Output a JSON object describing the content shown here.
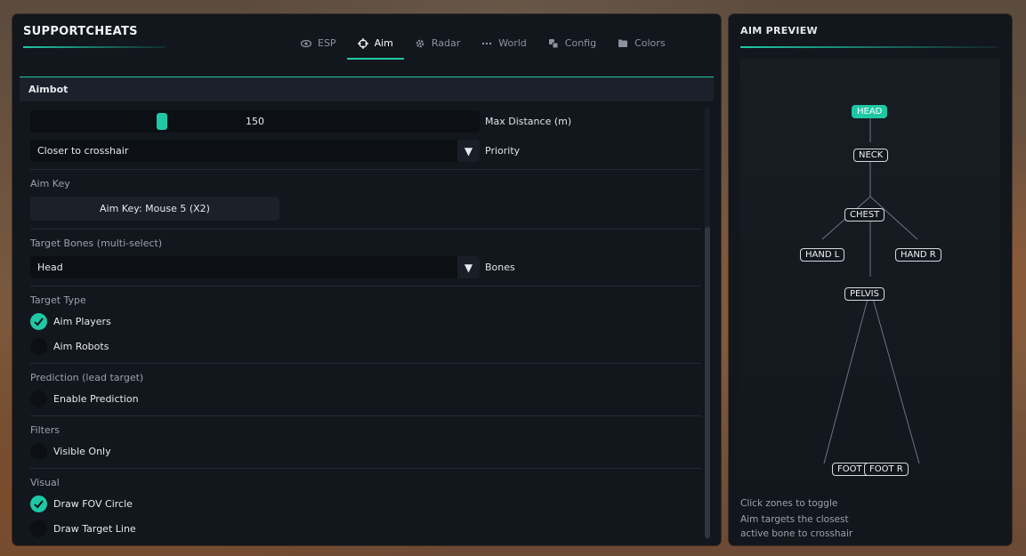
{
  "brand": "SUPPORTCHEATS",
  "tabs": [
    {
      "label": "ESP",
      "icon": "eye-icon"
    },
    {
      "label": "Aim",
      "icon": "crosshair-icon",
      "active": true
    },
    {
      "label": "Radar",
      "icon": "gear-icon"
    },
    {
      "label": "World",
      "icon": "dots-icon"
    },
    {
      "label": "Config",
      "icon": "config-icon"
    },
    {
      "label": "Colors",
      "icon": "folder-icon"
    }
  ],
  "section": "Aimbot",
  "max_distance": {
    "value": "150",
    "label": "Max Distance (m)",
    "fraction": 0.295
  },
  "priority": {
    "value": "Closer to crosshair",
    "label": "Priority"
  },
  "aim_key": {
    "title": "Aim Key",
    "button": "Aim Key: Mouse 5 (X2)"
  },
  "target_bones": {
    "title": "Target Bones (multi-select)",
    "value": "Head",
    "label": "Bones"
  },
  "target_type": {
    "title": "Target Type",
    "items": [
      {
        "label": "Aim Players",
        "checked": true
      },
      {
        "label": "Aim Robots",
        "checked": false
      }
    ]
  },
  "prediction": {
    "title": "Prediction (lead target)",
    "items": [
      {
        "label": "Enable Prediction",
        "checked": false
      }
    ]
  },
  "filters": {
    "title": "Filters",
    "items": [
      {
        "label": "Visible Only",
        "checked": false
      }
    ]
  },
  "visual": {
    "title": "Visual",
    "items": [
      {
        "label": "Draw FOV Circle",
        "checked": true
      },
      {
        "label": "Draw Target Line",
        "checked": false
      }
    ]
  },
  "preview": {
    "title": "AIM PREVIEW",
    "bones": {
      "head": "HEAD",
      "neck": "NECK",
      "chest": "CHEST",
      "hand_l": "HAND L",
      "hand_r": "HAND R",
      "pelvis": "PELVIS",
      "foot_l": "FOOT L",
      "foot_r": "FOOT R"
    },
    "active_bone": "HEAD",
    "help": [
      "Click zones to toggle",
      "Aim targets the closest",
      "active bone to crosshair"
    ]
  },
  "colors": {
    "accent": "#1fc8a5",
    "panel": "#12161d"
  }
}
